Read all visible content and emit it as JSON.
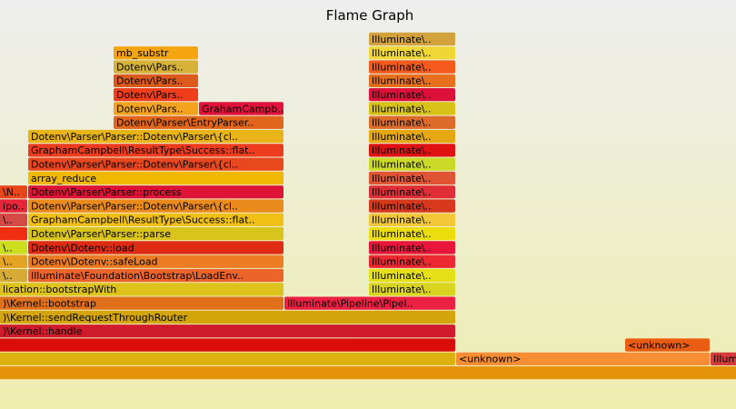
{
  "chart_data": {
    "type": "flamegraph",
    "title": "Flame Graph",
    "frames": [
      {
        "label": "",
        "color": "#e5930a",
        "level": 0,
        "start": -2,
        "end": 812
      },
      {
        "label": "",
        "color": "#ddb20e",
        "level": 1,
        "start": -2,
        "end": 501
      },
      {
        "label": "<unknown>",
        "color": "#f78e35",
        "level": 1,
        "start": 502,
        "end": 781
      },
      {
        "label": "Illum",
        "color": "#d63b3b",
        "level": 1,
        "start": 782,
        "end": 812
      },
      {
        "label": "",
        "color": "#d90e0a",
        "level": 2,
        "start": -2,
        "end": 501
      },
      {
        "label": "<unknown>",
        "color": "#ec5d14",
        "level": 2,
        "start": 688,
        "end": 781
      },
      {
        "label": ")\\Kernel::handle",
        "color": "#d01b2c",
        "level": 3,
        "start": -2,
        "end": 501
      },
      {
        "label": ")\\Kernel::sendRequestThroughRouter",
        "color": "#d4a50b",
        "level": 4,
        "start": -2,
        "end": 501
      },
      {
        "label": ")\\Kernel::bootstrap",
        "color": "#e0701a",
        "level": 5,
        "start": -2,
        "end": 312
      },
      {
        "label": "Illuminate\\Pipeline\\Pipel..",
        "color": "#ec2043",
        "level": 5,
        "start": 313,
        "end": 501
      },
      {
        "label": "lication::bootstrapWith",
        "color": "#dcc21a",
        "level": 6,
        "start": -2,
        "end": 312
      },
      {
        "label": "Illuminate\\..",
        "color": "#d9d41f",
        "level": 6,
        "start": 406,
        "end": 501
      },
      {
        "label": "\\..",
        "color": "#d6aa36",
        "level": 7,
        "start": -2,
        "end": 30
      },
      {
        "label": "Illuminate\\Foundation\\Bootstrap\\LoadEnv..",
        "color": "#ec642a",
        "level": 7,
        "start": 31,
        "end": 312
      },
      {
        "label": "Illuminate\\..",
        "color": "#e6e018",
        "level": 7,
        "start": 406,
        "end": 501
      },
      {
        "label": "\\..",
        "color": "#e6a322",
        "level": 8,
        "start": -2,
        "end": 30
      },
      {
        "label": "Dotenv\\Dotenv::safeLoad",
        "color": "#ec7c24",
        "level": 8,
        "start": 31,
        "end": 312
      },
      {
        "label": "Illuminate\\..",
        "color": "#ec2830",
        "level": 8,
        "start": 406,
        "end": 501
      },
      {
        "label": "\\..",
        "color": "#ccde1c",
        "level": 9,
        "start": -2,
        "end": 30
      },
      {
        "label": "Dotenv\\Dotenv::load",
        "color": "#e02b14",
        "level": 9,
        "start": 31,
        "end": 312
      },
      {
        "label": "Illuminate\\..",
        "color": "#e9163c",
        "level": 9,
        "start": 406,
        "end": 501
      },
      {
        "label": "",
        "color": "#f02e10",
        "level": 10,
        "start": -2,
        "end": 30
      },
      {
        "label": "Dotenv\\Parser\\Parser::parse",
        "color": "#d9c41c",
        "level": 10,
        "start": 31,
        "end": 312
      },
      {
        "label": "Illuminate\\..",
        "color": "#ebdd0e",
        "level": 10,
        "start": 406,
        "end": 501
      },
      {
        "label": "\\..",
        "color": "#d64a45",
        "level": 11,
        "start": -2,
        "end": 30
      },
      {
        "label": "GraphamCampbell\\ResultType\\Success::flat..",
        "color": "#f0c016",
        "level": 11,
        "start": 31,
        "end": 312
      },
      {
        "label": "Illuminate\\..",
        "color": "#f2c83a",
        "level": 11,
        "start": 406,
        "end": 501
      },
      {
        "label": "ipo..",
        "color": "#e7243a",
        "level": 12,
        "start": -2,
        "end": 30
      },
      {
        "label": "Dotenv\\Parser\\Parser::Dotenv\\Parser\\{cl..",
        "color": "#eb8a1d",
        "level": 12,
        "start": 31,
        "end": 312
      },
      {
        "label": "Illuminate\\..",
        "color": "#d8381b",
        "level": 12,
        "start": 406,
        "end": 501
      },
      {
        "label": "\\N..",
        "color": "#e6461a",
        "level": 13,
        "start": -2,
        "end": 30
      },
      {
        "label": "Dotenv\\Parser\\Parser::process",
        "color": "#de1437",
        "level": 13,
        "start": 31,
        "end": 312
      },
      {
        "label": "Illuminate\\..",
        "color": "#e02e36",
        "level": 13,
        "start": 406,
        "end": 501
      },
      {
        "label": "array_reduce",
        "color": "#f0b800",
        "level": 14,
        "start": 31,
        "end": 312
      },
      {
        "label": "Illuminate\\..",
        "color": "#e05333",
        "level": 14,
        "start": 406,
        "end": 501
      },
      {
        "label": "Dotenv\\Parser\\Parser::Dotenv\\Parser\\{cl..",
        "color": "#e9471e",
        "level": 15,
        "start": 31,
        "end": 312
      },
      {
        "label": "Illuminate\\..",
        "color": "#cada26",
        "level": 15,
        "start": 406,
        "end": 501
      },
      {
        "label": "GraphamCampbell\\ResultType\\Success::flat..",
        "color": "#ed3c1e",
        "level": 16,
        "start": 31,
        "end": 312
      },
      {
        "label": "Illuminate\\..",
        "color": "#e31212",
        "level": 16,
        "start": 406,
        "end": 501
      },
      {
        "label": "Dotenv\\Parser\\Parser::Dotenv\\Parser\\{cl..",
        "color": "#e8b418",
        "level": 17,
        "start": 31,
        "end": 312
      },
      {
        "label": "Illuminate\\..",
        "color": "#e5a812",
        "level": 17,
        "start": 406,
        "end": 501
      },
      {
        "label": "Dotenv\\Parser\\EntryParser..",
        "color": "#e1651a",
        "level": 18,
        "start": 125,
        "end": 312
      },
      {
        "label": "Illuminate\\..",
        "color": "#dd6c2a",
        "level": 18,
        "start": 406,
        "end": 501
      },
      {
        "label": "Dotenv\\Pars..",
        "color": "#f4a31f",
        "level": 19,
        "start": 125,
        "end": 218
      },
      {
        "label": "GrahamCampb..",
        "color": "#e2133a",
        "level": 19,
        "start": 219,
        "end": 312
      },
      {
        "label": "Illuminate\\..",
        "color": "#d8c218",
        "level": 19,
        "start": 406,
        "end": 501
      },
      {
        "label": "Dotenv\\Pars..",
        "color": "#f03d1c",
        "level": 20,
        "start": 125,
        "end": 218
      },
      {
        "label": "Illuminate\\..",
        "color": "#dc1038",
        "level": 20,
        "start": 406,
        "end": 501
      },
      {
        "label": "Dotenv\\Pars..",
        "color": "#db5a1c",
        "level": 21,
        "start": 125,
        "end": 218
      },
      {
        "label": "Illuminate\\..",
        "color": "#e6701e",
        "level": 21,
        "start": 406,
        "end": 501
      },
      {
        "label": "Dotenv\\Pars..",
        "color": "#d6b238",
        "level": 22,
        "start": 125,
        "end": 218
      },
      {
        "label": "Illuminate\\..",
        "color": "#f35a1c",
        "level": 22,
        "start": 406,
        "end": 501
      },
      {
        "label": "mb_substr",
        "color": "#f5a510",
        "level": 23,
        "start": 125,
        "end": 218
      },
      {
        "label": "Illuminate\\..",
        "color": "#f1d735",
        "level": 23,
        "start": 406,
        "end": 501
      },
      {
        "label": "Illuminate\\..",
        "color": "#d4a23c",
        "level": 24,
        "start": 406,
        "end": 501
      }
    ]
  }
}
